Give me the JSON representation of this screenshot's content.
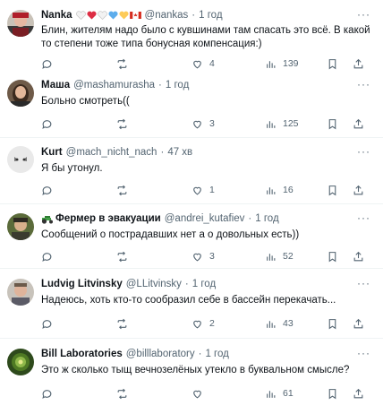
{
  "tweets": [
    {
      "name": "Nanka",
      "handle": "@nankas",
      "dot": "·",
      "time": "1 год",
      "text": "Блин, жителям надо было с кувшинами там спасать это всё. В какой то степени тоже типа бонусная компенсация:)",
      "replies": "",
      "retweets": "",
      "likes": "4",
      "views": "139",
      "emojis": [
        "white-heart",
        "red-heart",
        "white-heart",
        "blue-heart",
        "yellow-heart",
        "canada-flag"
      ]
    },
    {
      "name": "Маша",
      "handle": "@mashamurasha",
      "dot": "·",
      "time": "1 год",
      "text": "Больно смотреть((",
      "replies": "",
      "retweets": "",
      "likes": "3",
      "views": "125"
    },
    {
      "name": "Kurt",
      "handle": "@mach_nicht_nach",
      "dot": "·",
      "time": "47 хв",
      "text": "Я бы утонул.",
      "replies": "",
      "retweets": "",
      "likes": "1",
      "views": "16"
    },
    {
      "name": "Фермер в эвакуации",
      "handle": "@andrei_kutafiev",
      "dot": "·",
      "time": "1 год",
      "text": "Сообщений о пострадавших нет а о довольных есть))",
      "replies": "",
      "retweets": "",
      "likes": "3",
      "views": "52"
    },
    {
      "name": "Ludvig Litvinsky",
      "handle": "@LLitvinsky",
      "dot": "·",
      "time": "1 год",
      "text": "Надеюсь, хоть кто-то сообразил себе в бассейн перекачать...",
      "replies": "",
      "retweets": "",
      "likes": "2",
      "views": "43"
    },
    {
      "name": "Bill Laboratories",
      "handle": "@billlaboratory",
      "dot": "·",
      "time": "1 год",
      "text": "Это ж сколько тыщ вечнозелёных утекло в буквальном смысле?",
      "replies": "",
      "retweets": "",
      "likes": "",
      "views": "61"
    }
  ],
  "more_label": "···",
  "colors": {
    "text": "#0f1419",
    "muted": "#536471",
    "divider": "#eff3f4"
  }
}
